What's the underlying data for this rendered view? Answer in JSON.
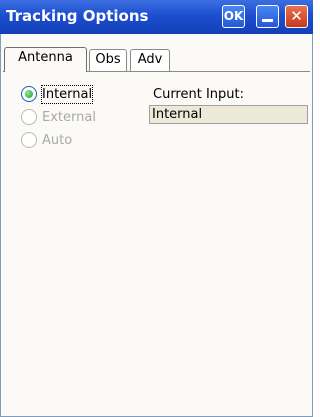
{
  "window": {
    "title": "Tracking Options",
    "ok_label": "OK",
    "minimize_icon": "minimize-icon",
    "close_icon": "close-icon",
    "close_glyph": "✕"
  },
  "tabs": [
    {
      "label": "Antenna",
      "active": true
    },
    {
      "label": "Obs",
      "active": false
    },
    {
      "label": "Adv",
      "active": false
    }
  ],
  "antenna": {
    "options": [
      {
        "label": "Internal",
        "selected": true,
        "enabled": true
      },
      {
        "label": "External",
        "selected": false,
        "enabled": false
      },
      {
        "label": "Auto",
        "selected": false,
        "enabled": false
      }
    ],
    "current_input_label": "Current Input:",
    "current_input_value": "Internal"
  },
  "colors": {
    "titlebar": "#1c4ed0",
    "close_button": "#c8381c",
    "radio_selected": "#1e9e2e"
  }
}
